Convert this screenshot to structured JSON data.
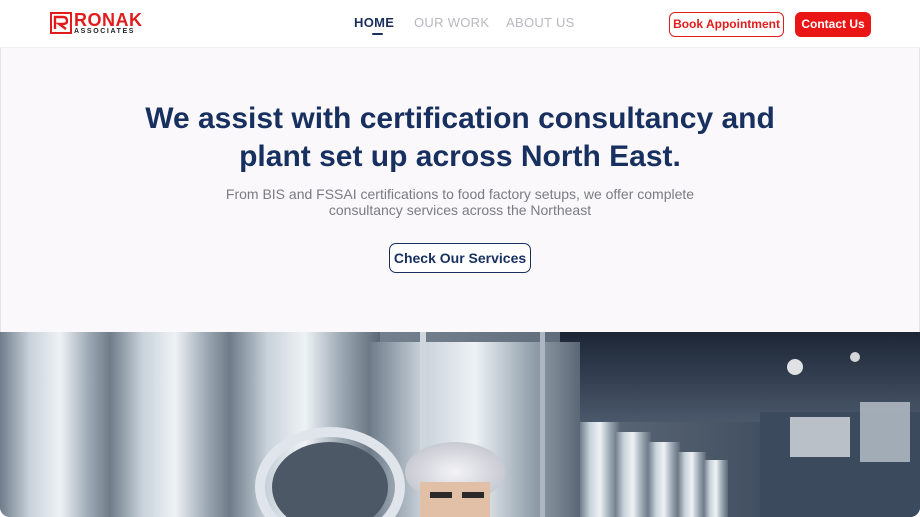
{
  "brand": {
    "name": "RONAK",
    "subtitle": "ASSOCIATES",
    "color": "#e21c1c"
  },
  "nav": {
    "items": [
      {
        "label": "HOME",
        "active": true
      },
      {
        "label": "OUR WORK",
        "active": false
      },
      {
        "label": "ABOUT US",
        "active": false
      }
    ]
  },
  "header_actions": {
    "book_label": "Book Appointment",
    "contact_label": "Contact Us"
  },
  "hero": {
    "title_line1": "We assist with certification consultancy and",
    "title_line2": "plant set up across North East.",
    "subtitle_line1": "From BIS and FSSAI certifications to food factory setups, we offer complete",
    "subtitle_line2": "consultancy services across the Northeast",
    "cta_label": "Check Our Services"
  },
  "colors": {
    "navy": "#17305f",
    "accent_red": "#ea1515",
    "muted_text": "#7a7b82",
    "background": "#faf8fa"
  }
}
